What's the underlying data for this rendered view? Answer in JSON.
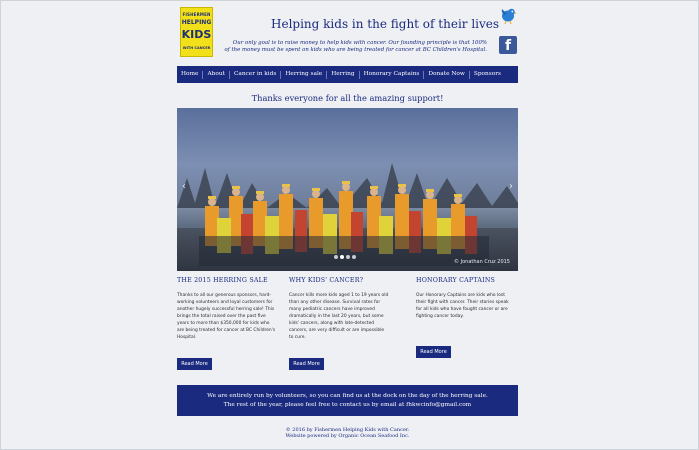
{
  "logo": {
    "line1": "FISHERMEN",
    "line2": "HELPING",
    "line3": "KIDS",
    "line4": "WITH CANCER"
  },
  "header": {
    "title": "Helping kids in the fight of their lives",
    "tagline_1": "Our only goal is to raise money to help kids with cancer. Our founding principle is that 100%",
    "tagline_2": "of the money must be spent on kids who are being treated for cancer at BC Children's Hospital."
  },
  "nav": {
    "items": [
      "Home",
      "About",
      "Cancer in kids",
      "Herring sale",
      "Herring",
      "Honorary Captains",
      "Donate Now",
      "Sponsors"
    ]
  },
  "hero": {
    "thanks": "Thanks everyone for all the amazing support!",
    "credit": "© Jonathan Cruz 2015"
  },
  "columns": [
    {
      "heading": "THE 2015 HERRING SALE",
      "text": "Thanks to all our generous sponsors, hard-working volunteers and loyal customers for another hugely successful herring sale! This brings the total raised over the past five years to more than $350,000 for kids who are being treated for cancer at BC Children's Hospital.",
      "button": "Read More"
    },
    {
      "heading": "WHY KIDS' CANCER?",
      "text": "Cancer kills more kids aged 1 to 19 years old than any other disease. Survival rates for many pediatric cancers have improved dramatically in the last 20 years, but some kids' cancers, along with late-detected cancers, are very difficult or are impossible to cure.",
      "button": "Read More"
    },
    {
      "heading": "HONORARY CAPTAINS",
      "text": "Our Honorary Captains are kids who lost their fight with cancer. Their stories speak for all kids who have fought cancer or are fighting cancer today.",
      "button": "Read More"
    }
  ],
  "footer": {
    "band_1": "We are entirely run by volunteers, so you can find us at the dock on the day of the herring sale.",
    "band_2": "The rest of the year, please feel free to contact us by email at fhkwcinfo@gmail.com",
    "copy_1": "© 2016 by Fishermen Helping Kids with Cancer.",
    "copy_2": "Website powered by Organic Ocean Seafood Inc."
  },
  "colors": {
    "brand": "#1a2a7e",
    "logo_yellow": "#f2e11a",
    "facebook": "#3b5998"
  },
  "icons": {
    "twitter": "twitter-bird-icon",
    "facebook": "facebook-icon"
  }
}
